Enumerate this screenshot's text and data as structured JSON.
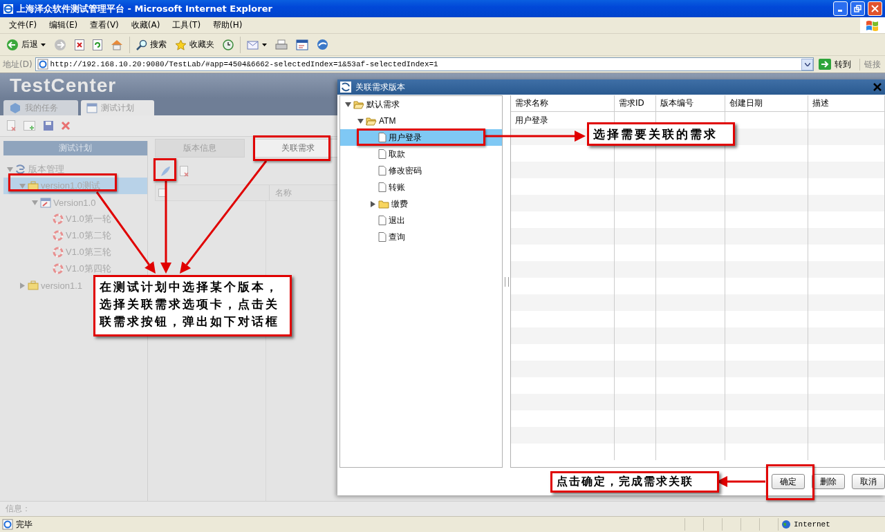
{
  "window": {
    "title": "上海泽众软件测试管理平台 - Microsoft Internet Explorer"
  },
  "menu": [
    "文件(F)",
    "编辑(E)",
    "查看(V)",
    "收藏(A)",
    "工具(T)",
    "帮助(H)"
  ],
  "toolbar": {
    "back": "后退",
    "search": "搜索",
    "favorites": "收藏夹"
  },
  "address": {
    "label": "地址(D)",
    "url": "http://192.168.10.20:9080/TestLab/#app=4504&6662-selectedIndex=1&53af-selectedIndex=1",
    "go": "转到",
    "links": "链接"
  },
  "app": {
    "logo": "TestCenter",
    "tabs": [
      {
        "label": "我的任务",
        "selected": false
      },
      {
        "label": "测试计划",
        "selected": true
      }
    ],
    "panel_title": "测试计划",
    "tree": [
      {
        "label": "版本管理",
        "kind": "root",
        "expanded": true,
        "selected": false,
        "children": [
          {
            "label": "version1.0测试",
            "kind": "version",
            "expanded": true,
            "selected": true,
            "children": [
              {
                "label": "Version1.0",
                "kind": "plan",
                "expanded": true,
                "selected": false,
                "children": [
                  {
                    "label": "V1.0第一轮",
                    "kind": "round",
                    "selected": false
                  },
                  {
                    "label": "V1.0第二轮",
                    "kind": "round",
                    "selected": false
                  },
                  {
                    "label": "V1.0第三轮",
                    "kind": "round",
                    "selected": false
                  },
                  {
                    "label": "V1.0第四轮",
                    "kind": "round",
                    "selected": false
                  }
                ]
              }
            ]
          },
          {
            "label": "version1.1",
            "kind": "version",
            "expanded": false,
            "selected": false
          }
        ]
      }
    ],
    "subtabs": [
      {
        "label": "版本信息",
        "selected": false
      },
      {
        "label": "关联需求",
        "selected": true
      }
    ],
    "grid_column": "名称",
    "info_label": "信息："
  },
  "dialog": {
    "title": "关联需求版本",
    "tree": [
      {
        "label": "默认需求",
        "kind": "folder",
        "expanded": true,
        "selected": false,
        "children": [
          {
            "label": "ATM",
            "kind": "folder",
            "expanded": true,
            "selected": false,
            "children": [
              {
                "label": "用户登录",
                "kind": "file",
                "selected": true
              },
              {
                "label": "取款",
                "kind": "file",
                "selected": false
              },
              {
                "label": "修改密码",
                "kind": "file",
                "selected": false
              },
              {
                "label": "转账",
                "kind": "file",
                "selected": false
              },
              {
                "label": "缴费",
                "kind": "folder",
                "expanded": false,
                "selected": false
              },
              {
                "label": "退出",
                "kind": "file",
                "selected": false
              },
              {
                "label": "查询",
                "kind": "file",
                "selected": false
              }
            ]
          }
        ]
      }
    ],
    "columns": [
      "需求名称",
      "需求ID",
      "版本编号",
      "创建日期",
      "描述"
    ],
    "rows": [
      {
        "name": "用户登录"
      }
    ],
    "buttons": [
      "确定",
      "删除",
      "取消"
    ]
  },
  "annotations": [
    "在测试计划中选择某个版本，选择关联需求选项卡，点击关联需求按钮，弹出如下对话框",
    "选择需要关联的需求",
    "点击确定，完成需求关联"
  ],
  "status_bar": {
    "text": "完毕",
    "zone": "Internet"
  }
}
